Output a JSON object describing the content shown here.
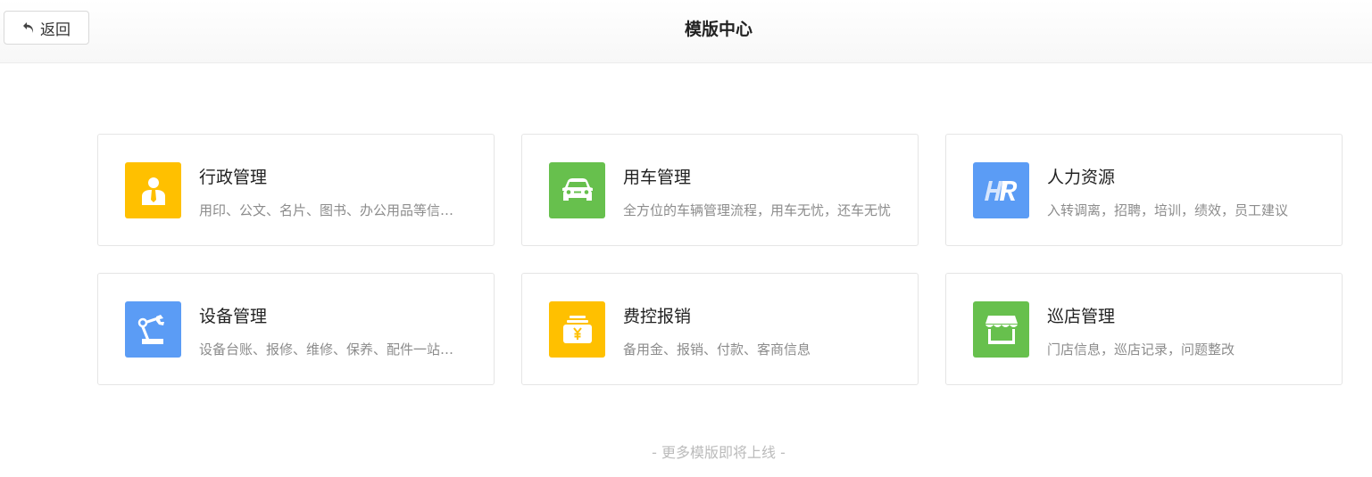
{
  "header": {
    "back_label": "返回",
    "title": "模版中心"
  },
  "templates": [
    {
      "title": "行政管理",
      "desc": "用印、公文、名片、图书、办公用品等信息管理",
      "icon": "admin-person-icon",
      "color": "#ffc000"
    },
    {
      "title": "用车管理",
      "desc": "全方位的车辆管理流程，用车无忧，还车无忧",
      "icon": "car-icon",
      "color": "#67c04d"
    },
    {
      "title": "人力资源",
      "desc": "入转调离，招聘，培训，绩效，员工建议",
      "icon": "hr-icon",
      "color": "#5b9cf5"
    },
    {
      "title": "设备管理",
      "desc": "设备台账、报修、维修、保养、配件一站式管理",
      "icon": "robot-arm-icon",
      "color": "#5b9cf5"
    },
    {
      "title": "费控报销",
      "desc": "备用金、报销、付款、客商信息",
      "icon": "money-box-icon",
      "color": "#ffc000"
    },
    {
      "title": "巡店管理",
      "desc": "门店信息，巡店记录，问题整改",
      "icon": "store-icon",
      "color": "#67c04d"
    }
  ],
  "footer": {
    "note": "- 更多模版即将上线 -"
  }
}
